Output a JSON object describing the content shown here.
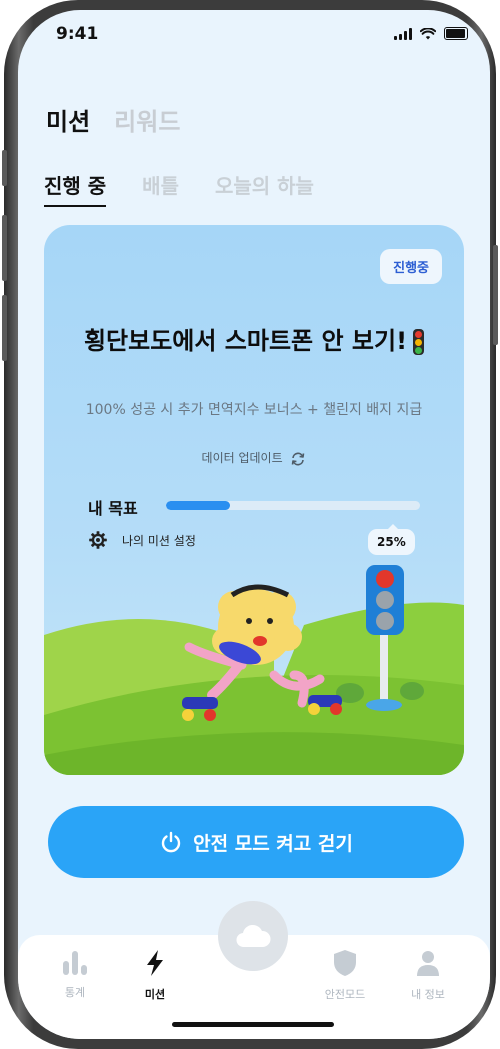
{
  "status_bar": {
    "time": "9:41"
  },
  "top_tabs": [
    {
      "label": "미션",
      "active": true
    },
    {
      "label": "리워드",
      "active": false
    }
  ],
  "sub_tabs": [
    {
      "label": "진행 중",
      "active": true
    },
    {
      "label": "배틀",
      "active": false
    },
    {
      "label": "오늘의 하늘",
      "active": false
    }
  ],
  "mission_card": {
    "badge": "진행중",
    "title": "횡단보도에서 스마트폰 안 보기!",
    "description": "100% 성공 시 추가 면역지수 보너스 + 챌린지 배지 지급",
    "update_label": "데이터 업데이트",
    "goal_label": "내 목표",
    "progress_fraction": 0.25,
    "progress_label": "25%",
    "settings_label": "나의 미션 설정"
  },
  "cta_button": {
    "label": "안전 모드 켜고 걷기",
    "icon": "power-icon"
  },
  "bottom_nav": [
    {
      "label": "통계",
      "icon": "bar-chart-icon",
      "active": false
    },
    {
      "label": "미션",
      "icon": "lightning-icon",
      "active": true
    },
    {
      "label": "안전모드",
      "icon": "shield-icon",
      "active": false
    },
    {
      "label": "내 정보",
      "icon": "person-icon",
      "active": false
    }
  ],
  "center_button": {
    "icon": "cloud-icon"
  },
  "colors": {
    "accent": "#2aa4f7",
    "progress": "#2a8ff0",
    "badge_text": "#2d5fd3",
    "screen_bg": "#e9f4fd"
  }
}
